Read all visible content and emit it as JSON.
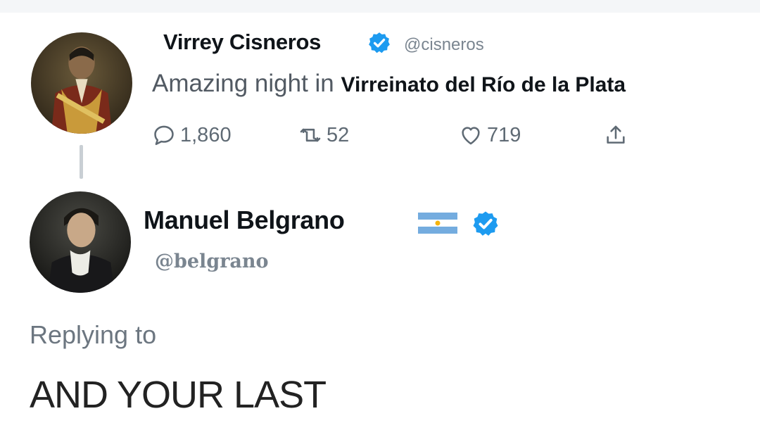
{
  "tweet": {
    "author_name": "Virrey Cisneros",
    "author_handle": "@cisneros",
    "text_plain": "Amazing night in ",
    "text_bold": "Virreinato del Río de la Plata",
    "stats": {
      "replies": "1,860",
      "retweets": "52",
      "likes": "719"
    },
    "avatar_icon": "portrait-cisneros-avatar"
  },
  "reply": {
    "author_name": "Manuel Belgrano",
    "author_handle": "@belgrano",
    "flag_icon": "argentina-flag-icon",
    "replying_label": "Replying to",
    "text": "AND YOUR LAST",
    "avatar_icon": "portrait-belgrano-avatar"
  },
  "colors": {
    "verified": "#1d9bf0",
    "text_primary": "#0f1419",
    "text_secondary": "#7a8590",
    "flag_blue": "#74acdf",
    "sun": "#f6b40e"
  }
}
